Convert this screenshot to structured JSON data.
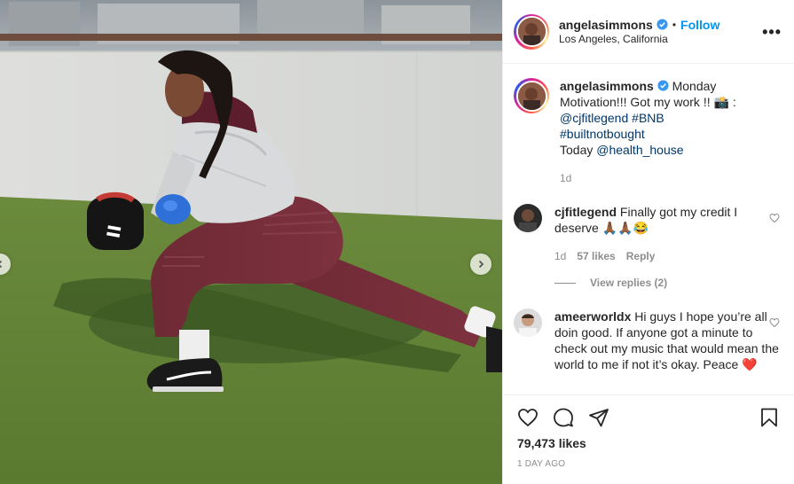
{
  "post": {
    "author": {
      "username": "angelasimmons",
      "verified_icon": "verified-badge-icon",
      "follow_label": "Follow",
      "separator": "•",
      "location": "Los Angeles, California"
    },
    "more_label": "•••",
    "caption": {
      "username": "angelasimmons",
      "text_1": "Monday Motivation!!! Got my work !! ",
      "camera_emoji": "📸",
      "text_2": " : ",
      "mention_1": "@cjfitlegend",
      "hashtag_1": "#BNB",
      "hashtag_2": "#builtnotbought",
      "text_3": "Today ",
      "mention_2": "@health_house",
      "time": "1d"
    },
    "comments": [
      {
        "username": "cjfitlegend",
        "text": "Finally got my credit I deserve 🙏🏾🙏🏾😂",
        "time": "1d",
        "likes": "57 likes",
        "reply_label": "Reply",
        "view_replies": "View replies (2)"
      },
      {
        "username": "ameerworldx",
        "text": "Hi guys I hope you’re all doin good. If anyone got a minute to check out my music that would mean the world to me if not it’s okay. Peace ❤️"
      }
    ],
    "likes_count": "79,473 likes",
    "age": "1 DAY AGO"
  },
  "colors": {
    "accent": "#0095f6",
    "mention": "#00376b",
    "muted": "#8e8e8e",
    "text": "#262626"
  }
}
